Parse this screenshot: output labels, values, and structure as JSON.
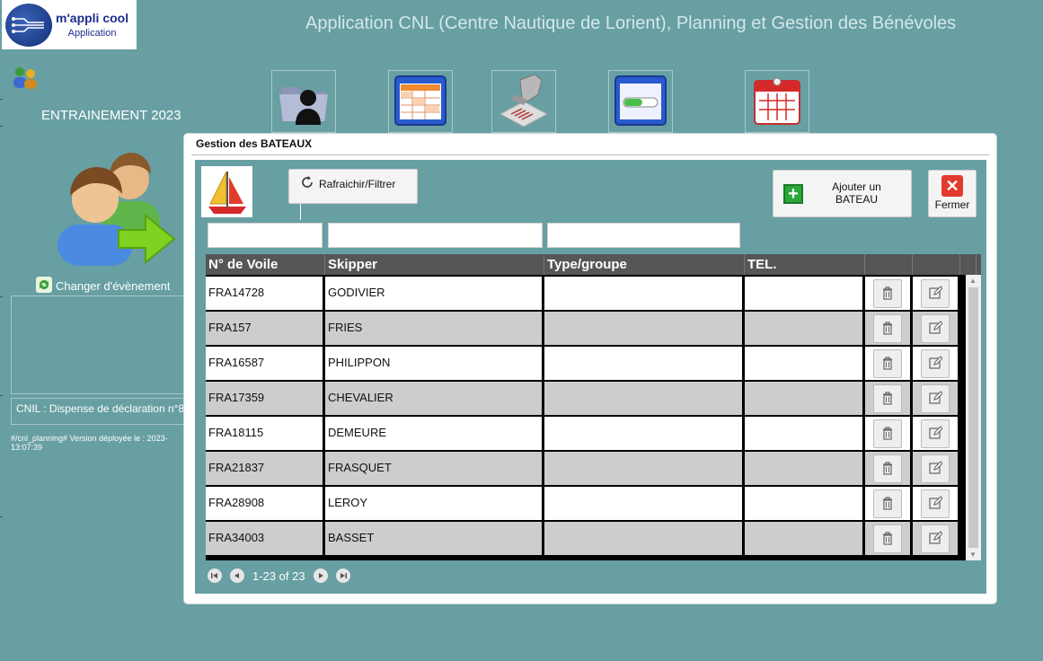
{
  "header": {
    "logo_line1": "m'appli cool",
    "logo_line2": "Application",
    "app_title": "Application CNL (Centre Nautique de Lorient), Planning et Gestion des Bénévoles"
  },
  "sidebar": {
    "event_name": "ENTRAINEMENT 2023",
    "change_event_label": "Changer d'évènement",
    "cnil_text": "CNIL : Dispense de déclaration n°8",
    "version_line1": "#/cnl_planning# Version déployée le : 2023-",
    "version_line2": "13:07:39"
  },
  "nav_icons": [
    "folder-user-icon",
    "table-window-icon",
    "barcode-scanner-icon",
    "progress-window-icon",
    "calendar-icon"
  ],
  "dialog": {
    "title": "Gestion des BATEAUX",
    "refresh_label": "Rafraichir/Filtrer",
    "add_label": "Ajouter un BATEAU",
    "close_label": "Fermer",
    "filters": [
      {
        "value": "",
        "placeholder": ""
      },
      {
        "value": "",
        "placeholder": ""
      },
      {
        "value": "",
        "placeholder": ""
      }
    ],
    "columns": [
      "N° de Voile",
      "Skipper",
      "Type/groupe",
      "TEL.",
      "",
      ""
    ],
    "rows": [
      {
        "voile": "FRA14728",
        "skipper": "GODIVIER",
        "type": "",
        "tel": ""
      },
      {
        "voile": "FRA157",
        "skipper": "FRIES",
        "type": "",
        "tel": ""
      },
      {
        "voile": "FRA16587",
        "skipper": "PHILIPPON",
        "type": "",
        "tel": ""
      },
      {
        "voile": "FRA17359",
        "skipper": "CHEVALIER",
        "type": "",
        "tel": ""
      },
      {
        "voile": "FRA18115",
        "skipper": "DEMEURE",
        "type": "",
        "tel": ""
      },
      {
        "voile": "FRA21837",
        "skipper": "FRASQUET",
        "type": "",
        "tel": ""
      },
      {
        "voile": "FRA28908",
        "skipper": "LEROY",
        "type": "",
        "tel": ""
      },
      {
        "voile": "FRA34003",
        "skipper": "BASSET",
        "type": "",
        "tel": ""
      }
    ],
    "pager_text": "1-23 of 23"
  },
  "colors": {
    "background": "#679fa3",
    "header_row": "#565656",
    "row_alt": "#cdcdcd",
    "close_red": "#e23a2c",
    "add_green": "#2aa83a"
  }
}
